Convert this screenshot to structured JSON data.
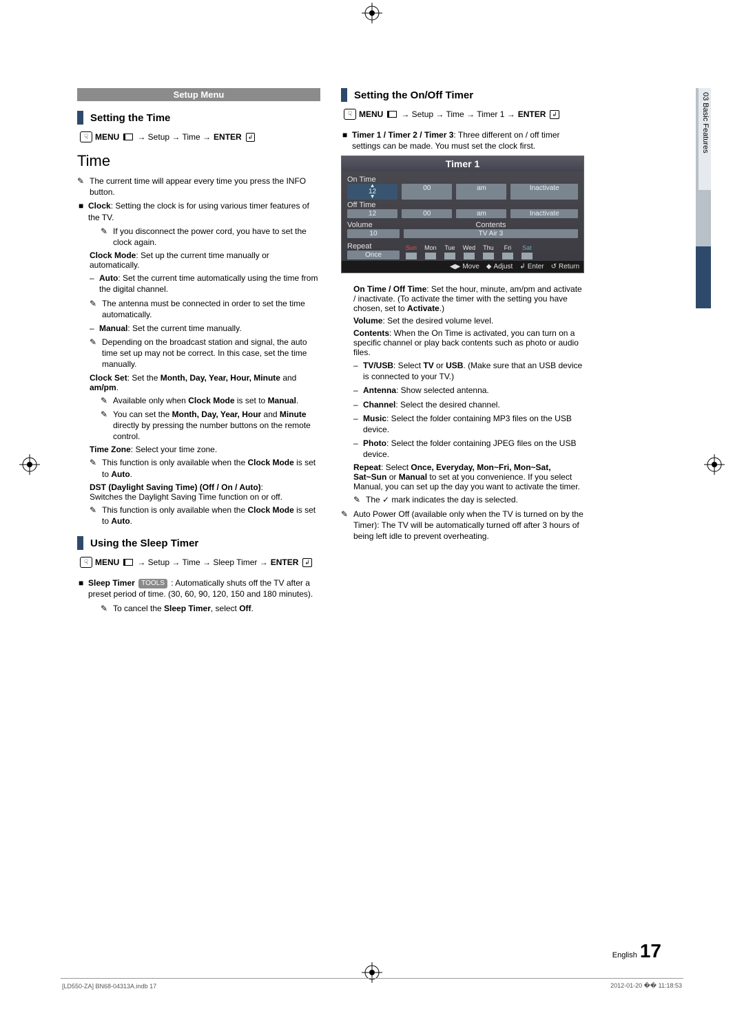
{
  "banner": "Setup Menu",
  "sections": {
    "setting_time": "Setting the Time",
    "using_sleep": "Using the Sleep Timer",
    "setting_onoff": "Setting the On/Off Timer"
  },
  "menu_label": "MENU",
  "enter_label": "ENTER",
  "paths": {
    "time": " → Setup → Time → ",
    "sleep": " → Setup → Time → Sleep Timer → ",
    "timer1": " → Setup → Time → Timer 1 → "
  },
  "time_heading": "Time",
  "left": {
    "info_note": "The current time will appear every time you press the INFO button.",
    "clock_intro": {
      "b": "Clock",
      "t": ": Setting the clock is for using various timer features of the TV."
    },
    "disconnect": "If you disconnect the power cord, you have to set the clock again.",
    "clock_mode": {
      "b": "Clock Mode",
      "t": ": Set up the current time manually or automatically."
    },
    "auto": {
      "b": "Auto",
      "t": ": Set the current time automatically using the time from the digital channel."
    },
    "antenna_note": "The antenna must be connected in order to set the time automatically.",
    "manual": {
      "b": "Manual",
      "t": ": Set the current time manually."
    },
    "broadcast_note": "Depending on the broadcast station and signal, the auto time set up may not be correct. In this case, set the time manually.",
    "clock_set_pre": "Clock Set",
    "clock_set_mid": ": Set the ",
    "clock_set_parts": "Month, Day, Year, Hour, Minute",
    "clock_set_post": " and ",
    "clock_set_ampm": "am/pm",
    "avail_only": "Available only when ",
    "avail_only2": " is set to ",
    "can_set": "You can set the ",
    "can_set_parts": "Month, Day, Year, Hour",
    "can_set_and": " and ",
    "minute": "Minute",
    "can_set_tail": " directly by pressing the number buttons on the remote control.",
    "time_zone": {
      "b": "Time Zone",
      "t": ": Select your time zone."
    },
    "only_auto": "This function is only available when the ",
    "set_auto": " is set to ",
    "dst_head": "DST (Daylight Saving Time) (Off / On / Auto)",
    "dst_body": "Switches the Daylight Saving Time function on or off.",
    "sleep_timer_b": "Sleep Timer",
    "sleep_timer_t": ": Automatically shuts off the TV after a preset period of time. (30, 60, 90, 120, 150 and 180 minutes).",
    "cancel_sleep_pre": "To cancel the ",
    "cancel_sleep_mid": ", select ",
    "off": "Off",
    "tools": "TOOLS"
  },
  "right": {
    "timer123": {
      "b": "Timer 1 / Timer 2 / Timer 3",
      "t": ": Three different on / off timer settings can be made. You must set the clock first."
    },
    "on_off_time": {
      "b": "On Time / Off Time",
      "t": ": Set the hour, minute, am/pm and activate / inactivate. (To activate the timer with the setting you have chosen, set to "
    },
    "activate": "Activate",
    "volume": {
      "b": "Volume",
      "t": ": Set the desired volume level."
    },
    "contents": {
      "b": "Contents",
      "t": ": When the On Time is activated, you can turn on a specific channel or play back contents such as photo or audio files."
    },
    "tvusb": {
      "b": "TV/USB",
      "t": ": Select ",
      "b2": "TV",
      "or": " or ",
      "b3": "USB",
      "t2": ". (Make sure that an USB device is connected to your TV.)"
    },
    "antenna_d": {
      "b": "Antenna",
      "t": ": Show selected antenna."
    },
    "channel": {
      "b": "Channel",
      "t": ": Select the desired channel."
    },
    "music": {
      "b": "Music",
      "t": ": Select the folder containing MP3 files on the USB device."
    },
    "photo": {
      "b": "Photo",
      "t": ": Select the folder containing JPEG files on the USB device."
    },
    "repeat_pre": "Repeat",
    "repeat_mid": ": Select ",
    "repeat_opts": "Once, Everyday, Mon~Fri, Mon~Sat, Sat~Sun",
    "repeat_or": " or ",
    "repeat_manual": "Manual",
    "repeat_tail": " to set at you convenience. If you select Manual, you can set up the day you want to activate the timer.",
    "check_note": "The ✓ mark indicates the day is selected.",
    "autopower": "Auto Power Off (available only when the TV is turned on by the Timer): The TV will be automatically turned off after 3 hours of being left idle to prevent overheating."
  },
  "timer_box": {
    "title": "Timer 1",
    "on_time": "On Time",
    "off_time": "Off Time",
    "row_on": [
      "12",
      "00",
      "am",
      "Inactivate"
    ],
    "row_off": [
      "12",
      "00",
      "am",
      "Inactivate"
    ],
    "volume_l": "Volume",
    "contents_l": "Contents",
    "vol_val": "10",
    "cont_val": "TV  Air  3",
    "repeat_l": "Repeat",
    "repeat_v": "Once",
    "days": [
      "Sun",
      "Mon",
      "Tue",
      "Wed",
      "Thu",
      "Fri",
      "Sat"
    ],
    "footer": [
      "Move",
      "Adjust",
      "Enter",
      "Return"
    ]
  },
  "side_tab": "03  Basic Features",
  "page_lang": "English",
  "page_num": "17",
  "footer_left": "[LD550-ZA] BN68-04313A.indb   17",
  "footer_right": "2012-01-20   �� 11:18:53"
}
